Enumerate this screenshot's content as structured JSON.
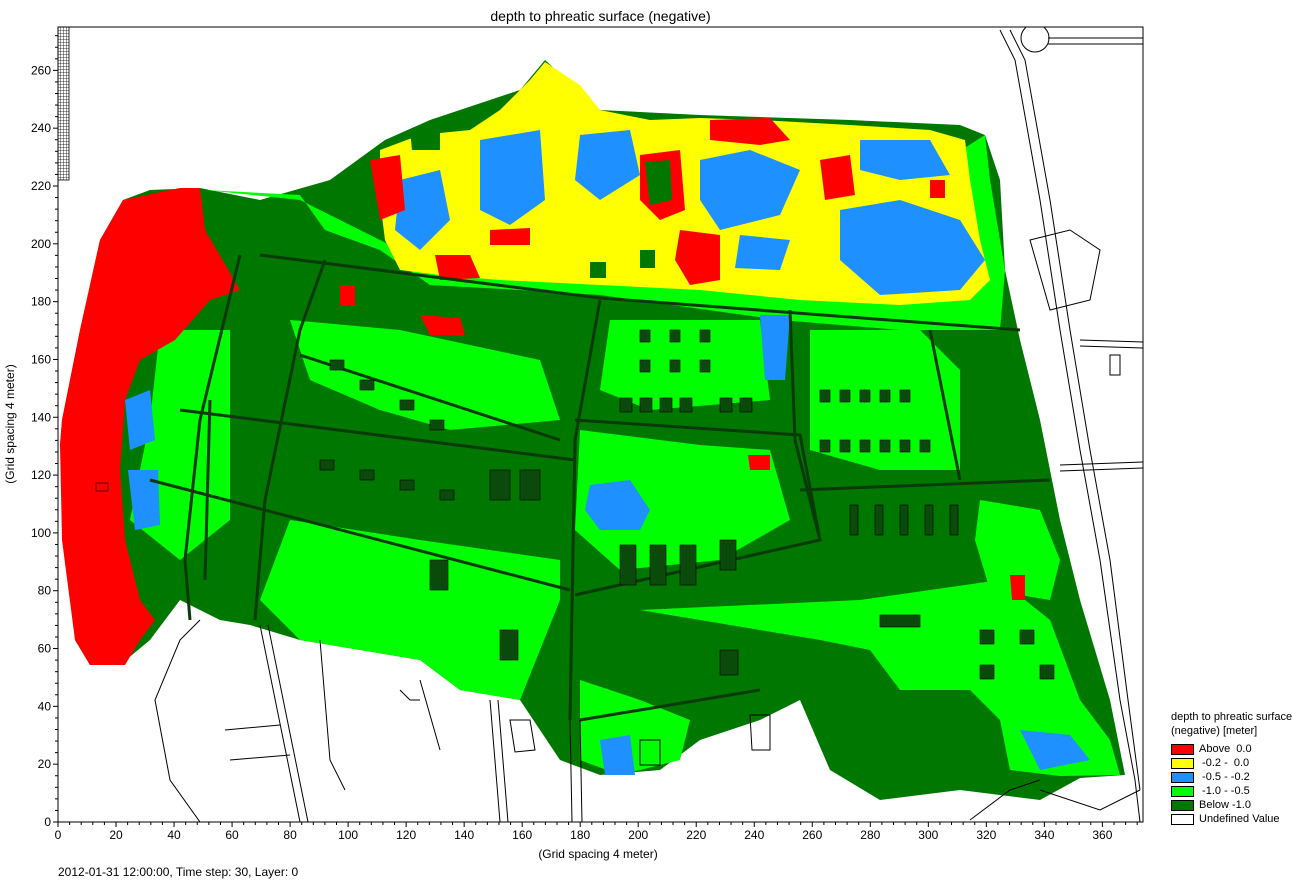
{
  "title": "depth to phreatic surface (negative)",
  "x_axis": {
    "label": "(Grid spacing 4 meter)",
    "range": [
      0,
      374
    ],
    "ticks": [
      "0",
      "20",
      "40",
      "60",
      "80",
      "100",
      "120",
      "140",
      "160",
      "180",
      "200",
      "220",
      "240",
      "260",
      "280",
      "300",
      "320",
      "340",
      "360"
    ]
  },
  "y_axis": {
    "label": "(Grid spacing 4 meter)",
    "range": [
      0,
      275
    ],
    "ticks": [
      "0",
      "20",
      "40",
      "60",
      "80",
      "100",
      "120",
      "140",
      "160",
      "180",
      "200",
      "220",
      "240",
      "260"
    ]
  },
  "status": "2012-01-31 12:00:00, Time step: 30, Layer: 0",
  "legend": {
    "title_line1": "depth to phreatic surface",
    "title_line2": "(negative) [meter]",
    "items": [
      {
        "label": "Above  0.0",
        "color": "#ff0000"
      },
      {
        "label": " -0.2 -  0.0",
        "color": "#ffff00"
      },
      {
        "label": " -0.5 - -0.2",
        "color": "#1e90ff"
      },
      {
        "label": " -1.0 - -0.5",
        "color": "#00ff00"
      },
      {
        "label": "Below -1.0",
        "color": "#007800"
      },
      {
        "label": "Undefined Value",
        "color": "#ffffff"
      }
    ]
  }
}
